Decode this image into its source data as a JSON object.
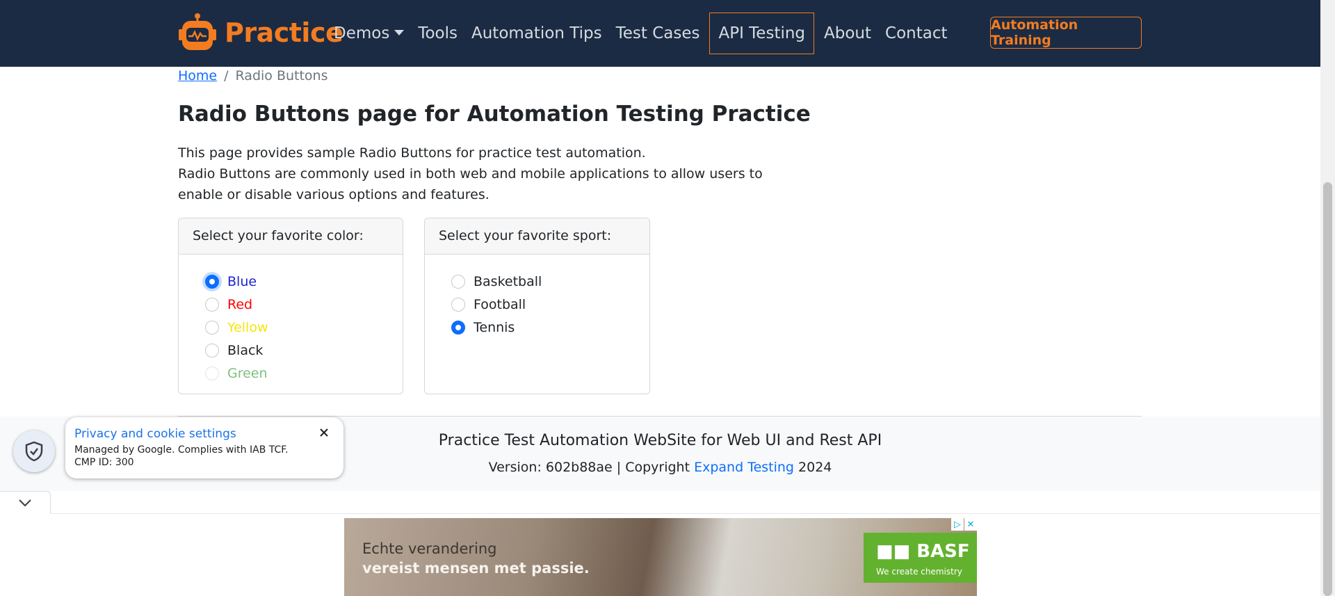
{
  "brand": {
    "name": "Practice"
  },
  "nav": {
    "items": [
      {
        "label": "Demos"
      },
      {
        "label": "Tools"
      },
      {
        "label": "Automation Tips"
      },
      {
        "label": "Test Cases"
      },
      {
        "label": "API Testing"
      },
      {
        "label": "About"
      },
      {
        "label": "Contact"
      }
    ],
    "training_label": "Automation Training"
  },
  "breadcrumb": {
    "home": "Home",
    "separator": "/",
    "current": "Radio Buttons"
  },
  "page": {
    "title": "Radio Buttons page for Automation Testing Practice",
    "intro_1": "This page provides sample Radio Buttons for practice test automation.",
    "intro_2": "Radio Buttons are commonly used in both web and mobile applications to allow users to enable or disable various options and features."
  },
  "color_card": {
    "header": "Select your favorite color:",
    "options": [
      {
        "label": "Blue",
        "color": "#1d23d6",
        "checked": true
      },
      {
        "label": "Red",
        "color": "#ff0000"
      },
      {
        "label": "Yellow",
        "color": "#f5e60f"
      },
      {
        "label": "Black",
        "color": "#212529"
      },
      {
        "label": "Green",
        "color": "#7fbf7f",
        "disabled": true
      }
    ]
  },
  "sport_card": {
    "header": "Select your favorite sport:",
    "options": [
      {
        "label": "Basketball"
      },
      {
        "label": "Football"
      },
      {
        "label": "Tennis",
        "checked": true
      }
    ]
  },
  "footer": {
    "title": "Practice Test Automation WebSite for Web UI and Rest API",
    "version_prefix": "Version: 602b88ae | Copyright ",
    "link": "Expand Testing",
    "year": " 2024"
  },
  "cookie": {
    "title": "Privacy and cookie settings",
    "line1": "Managed by Google. Complies with IAB TCF.",
    "line2": "CMP ID: 300"
  },
  "ad": {
    "line1": "Echte verandering",
    "line2": "vereist mensen met passie.",
    "logo": "BASF",
    "tagline": "We create chemistry"
  },
  "colors": {
    "navbar": "#1b2b43",
    "accent": "#f47c20",
    "link": "#0d6efd"
  }
}
